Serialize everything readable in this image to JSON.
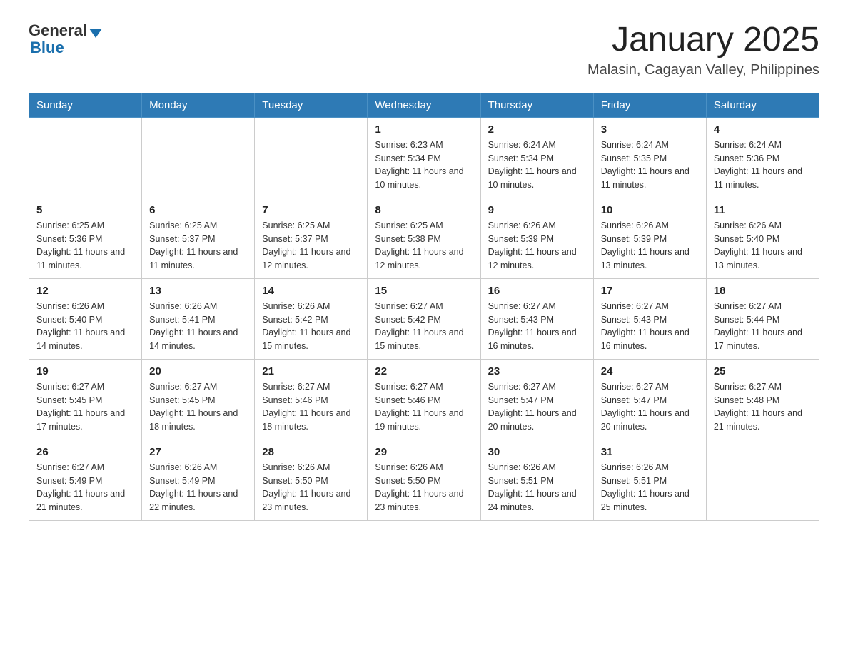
{
  "header": {
    "logo_general": "General",
    "logo_blue": "Blue",
    "month_title": "January 2025",
    "location": "Malasin, Cagayan Valley, Philippines"
  },
  "days_of_week": [
    "Sunday",
    "Monday",
    "Tuesday",
    "Wednesday",
    "Thursday",
    "Friday",
    "Saturday"
  ],
  "weeks": [
    [
      {
        "day": "",
        "sunrise": "",
        "sunset": "",
        "daylight": ""
      },
      {
        "day": "",
        "sunrise": "",
        "sunset": "",
        "daylight": ""
      },
      {
        "day": "",
        "sunrise": "",
        "sunset": "",
        "daylight": ""
      },
      {
        "day": "1",
        "sunrise": "Sunrise: 6:23 AM",
        "sunset": "Sunset: 5:34 PM",
        "daylight": "Daylight: 11 hours and 10 minutes."
      },
      {
        "day": "2",
        "sunrise": "Sunrise: 6:24 AM",
        "sunset": "Sunset: 5:34 PM",
        "daylight": "Daylight: 11 hours and 10 minutes."
      },
      {
        "day": "3",
        "sunrise": "Sunrise: 6:24 AM",
        "sunset": "Sunset: 5:35 PM",
        "daylight": "Daylight: 11 hours and 11 minutes."
      },
      {
        "day": "4",
        "sunrise": "Sunrise: 6:24 AM",
        "sunset": "Sunset: 5:36 PM",
        "daylight": "Daylight: 11 hours and 11 minutes."
      }
    ],
    [
      {
        "day": "5",
        "sunrise": "Sunrise: 6:25 AM",
        "sunset": "Sunset: 5:36 PM",
        "daylight": "Daylight: 11 hours and 11 minutes."
      },
      {
        "day": "6",
        "sunrise": "Sunrise: 6:25 AM",
        "sunset": "Sunset: 5:37 PM",
        "daylight": "Daylight: 11 hours and 11 minutes."
      },
      {
        "day": "7",
        "sunrise": "Sunrise: 6:25 AM",
        "sunset": "Sunset: 5:37 PM",
        "daylight": "Daylight: 11 hours and 12 minutes."
      },
      {
        "day": "8",
        "sunrise": "Sunrise: 6:25 AM",
        "sunset": "Sunset: 5:38 PM",
        "daylight": "Daylight: 11 hours and 12 minutes."
      },
      {
        "day": "9",
        "sunrise": "Sunrise: 6:26 AM",
        "sunset": "Sunset: 5:39 PM",
        "daylight": "Daylight: 11 hours and 12 minutes."
      },
      {
        "day": "10",
        "sunrise": "Sunrise: 6:26 AM",
        "sunset": "Sunset: 5:39 PM",
        "daylight": "Daylight: 11 hours and 13 minutes."
      },
      {
        "day": "11",
        "sunrise": "Sunrise: 6:26 AM",
        "sunset": "Sunset: 5:40 PM",
        "daylight": "Daylight: 11 hours and 13 minutes."
      }
    ],
    [
      {
        "day": "12",
        "sunrise": "Sunrise: 6:26 AM",
        "sunset": "Sunset: 5:40 PM",
        "daylight": "Daylight: 11 hours and 14 minutes."
      },
      {
        "day": "13",
        "sunrise": "Sunrise: 6:26 AM",
        "sunset": "Sunset: 5:41 PM",
        "daylight": "Daylight: 11 hours and 14 minutes."
      },
      {
        "day": "14",
        "sunrise": "Sunrise: 6:26 AM",
        "sunset": "Sunset: 5:42 PM",
        "daylight": "Daylight: 11 hours and 15 minutes."
      },
      {
        "day": "15",
        "sunrise": "Sunrise: 6:27 AM",
        "sunset": "Sunset: 5:42 PM",
        "daylight": "Daylight: 11 hours and 15 minutes."
      },
      {
        "day": "16",
        "sunrise": "Sunrise: 6:27 AM",
        "sunset": "Sunset: 5:43 PM",
        "daylight": "Daylight: 11 hours and 16 minutes."
      },
      {
        "day": "17",
        "sunrise": "Sunrise: 6:27 AM",
        "sunset": "Sunset: 5:43 PM",
        "daylight": "Daylight: 11 hours and 16 minutes."
      },
      {
        "day": "18",
        "sunrise": "Sunrise: 6:27 AM",
        "sunset": "Sunset: 5:44 PM",
        "daylight": "Daylight: 11 hours and 17 minutes."
      }
    ],
    [
      {
        "day": "19",
        "sunrise": "Sunrise: 6:27 AM",
        "sunset": "Sunset: 5:45 PM",
        "daylight": "Daylight: 11 hours and 17 minutes."
      },
      {
        "day": "20",
        "sunrise": "Sunrise: 6:27 AM",
        "sunset": "Sunset: 5:45 PM",
        "daylight": "Daylight: 11 hours and 18 minutes."
      },
      {
        "day": "21",
        "sunrise": "Sunrise: 6:27 AM",
        "sunset": "Sunset: 5:46 PM",
        "daylight": "Daylight: 11 hours and 18 minutes."
      },
      {
        "day": "22",
        "sunrise": "Sunrise: 6:27 AM",
        "sunset": "Sunset: 5:46 PM",
        "daylight": "Daylight: 11 hours and 19 minutes."
      },
      {
        "day": "23",
        "sunrise": "Sunrise: 6:27 AM",
        "sunset": "Sunset: 5:47 PM",
        "daylight": "Daylight: 11 hours and 20 minutes."
      },
      {
        "day": "24",
        "sunrise": "Sunrise: 6:27 AM",
        "sunset": "Sunset: 5:47 PM",
        "daylight": "Daylight: 11 hours and 20 minutes."
      },
      {
        "day": "25",
        "sunrise": "Sunrise: 6:27 AM",
        "sunset": "Sunset: 5:48 PM",
        "daylight": "Daylight: 11 hours and 21 minutes."
      }
    ],
    [
      {
        "day": "26",
        "sunrise": "Sunrise: 6:27 AM",
        "sunset": "Sunset: 5:49 PM",
        "daylight": "Daylight: 11 hours and 21 minutes."
      },
      {
        "day": "27",
        "sunrise": "Sunrise: 6:26 AM",
        "sunset": "Sunset: 5:49 PM",
        "daylight": "Daylight: 11 hours and 22 minutes."
      },
      {
        "day": "28",
        "sunrise": "Sunrise: 6:26 AM",
        "sunset": "Sunset: 5:50 PM",
        "daylight": "Daylight: 11 hours and 23 minutes."
      },
      {
        "day": "29",
        "sunrise": "Sunrise: 6:26 AM",
        "sunset": "Sunset: 5:50 PM",
        "daylight": "Daylight: 11 hours and 23 minutes."
      },
      {
        "day": "30",
        "sunrise": "Sunrise: 6:26 AM",
        "sunset": "Sunset: 5:51 PM",
        "daylight": "Daylight: 11 hours and 24 minutes."
      },
      {
        "day": "31",
        "sunrise": "Sunrise: 6:26 AM",
        "sunset": "Sunset: 5:51 PM",
        "daylight": "Daylight: 11 hours and 25 minutes."
      },
      {
        "day": "",
        "sunrise": "",
        "sunset": "",
        "daylight": ""
      }
    ]
  ]
}
